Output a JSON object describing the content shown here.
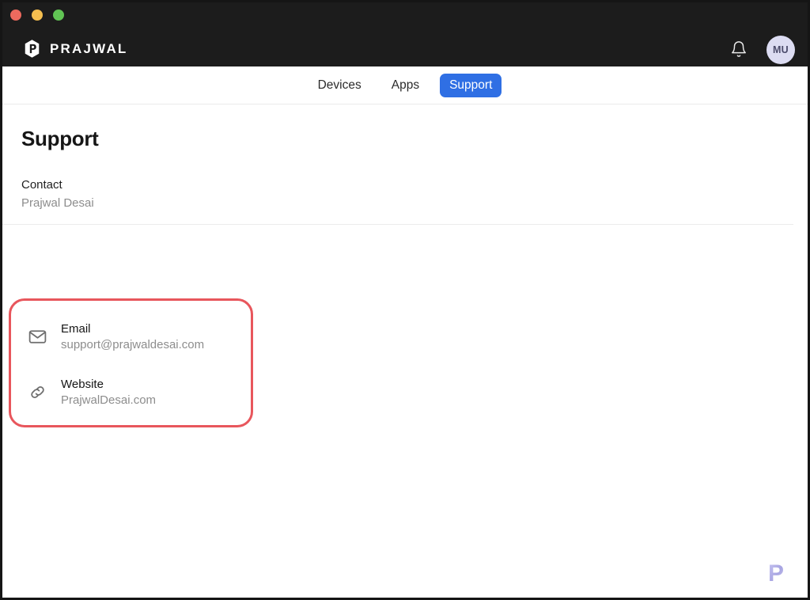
{
  "window": {
    "traffic_lights": [
      {
        "name": "close",
        "color": "#ED6A5E"
      },
      {
        "name": "minimize",
        "color": "#F4BE4F"
      },
      {
        "name": "zoom",
        "color": "#61C454"
      }
    ]
  },
  "header": {
    "brand_name": "PRAJWAL",
    "brand_icon": "hexagon-p-logo-icon",
    "notifications_icon": "bell-icon",
    "avatar_initials": "MU",
    "avatar_color": "#dcdcf2",
    "background_color": "#1c1c1c"
  },
  "nav": {
    "items": [
      {
        "label": "Devices",
        "active": false
      },
      {
        "label": "Apps",
        "active": false
      },
      {
        "label": "Support",
        "active": true
      }
    ],
    "active_color": "#2f6fe4"
  },
  "page": {
    "title": "Support",
    "contact": {
      "label": "Contact",
      "value": "Prajwal Desai"
    },
    "entries": [
      {
        "icon": "mail-icon",
        "label": "Email",
        "value": "support@prajwaldesai.com"
      },
      {
        "icon": "link-icon",
        "label": "Website",
        "value": "PrajwalDesai.com"
      }
    ],
    "highlight_color": "#e8565c"
  },
  "watermark": {
    "letter": "P",
    "color": "#8a86d8"
  }
}
